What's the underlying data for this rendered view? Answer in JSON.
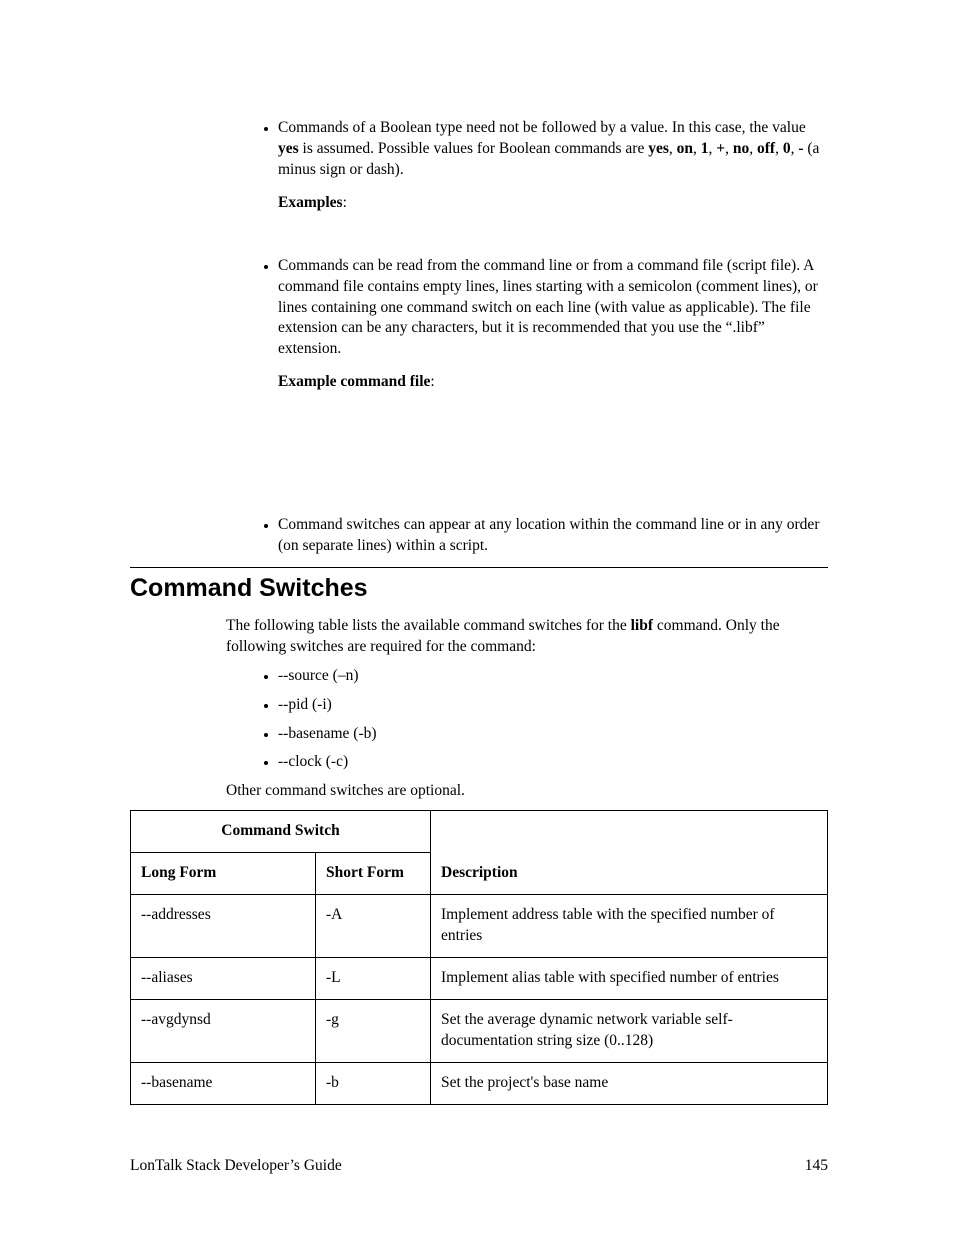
{
  "bullets_top": {
    "b1_pre": "Commands of a Boolean type need not be followed by a value.  In this case, the value ",
    "b1_yes": "yes",
    "b1_mid1": " is assumed.  Possible values for Boolean commands are ",
    "b1_v1": "yes",
    "b1_s1": ", ",
    "b1_v2": "on",
    "b1_s2": ", ",
    "b1_v3": "1",
    "b1_s3": ", ",
    "b1_v4": "+",
    "b1_s4": ", ",
    "b1_v5": "no",
    "b1_s5": ", ",
    "b1_v6": "off",
    "b1_s6": ", ",
    "b1_v7": "0",
    "b1_s7": ", ",
    "b1_v8": "-",
    "b1_tail": " (a minus sign or dash).",
    "examples_label": "Examples",
    "colon1": ":",
    "b2_text": "Commands can be read from the command line or from a command file (script file).  A command file contains empty lines, lines starting with a semicolon (comment lines), or lines containing one command switch on each line (with value as applicable).  The file extension can be any characters, but it is recommended that you use the “.libf” extension.",
    "example_cmd_file_label": "Example command file",
    "colon2": ":",
    "b3_text": "Command switches can appear at any location within the command line or in any order (on separate lines) within a script."
  },
  "section_heading": "Command Switches",
  "intro_pre": "The following table lists the available command switches for the ",
  "intro_bold": "libf",
  "intro_post": " command.  Only the following switches are required for the command:",
  "req_switches": [
    "--source (–n)",
    "--pid (-i)",
    "--basename (-b)",
    "--clock (-c)"
  ],
  "optional_note": "Other command switches are optional.",
  "table": {
    "header_group": "Command Switch",
    "header_long": "Long Form",
    "header_short": "Short Form",
    "header_desc": "Description",
    "rows": [
      {
        "long": "--addresses",
        "short": "-A",
        "desc": "Implement address table with the specified number of entries"
      },
      {
        "long": "--aliases",
        "short": "-L",
        "desc": "Implement alias table with specified number of entries"
      },
      {
        "long": "--avgdynsd",
        "short": "-g",
        "desc": "Set the average dynamic network variable self-documentation string size (0..128)"
      },
      {
        "long": "--basename",
        "short": "-b",
        "desc": "Set the project's base name"
      }
    ]
  },
  "footer": {
    "title": "LonTalk Stack Developer’s Guide",
    "page": "145"
  }
}
